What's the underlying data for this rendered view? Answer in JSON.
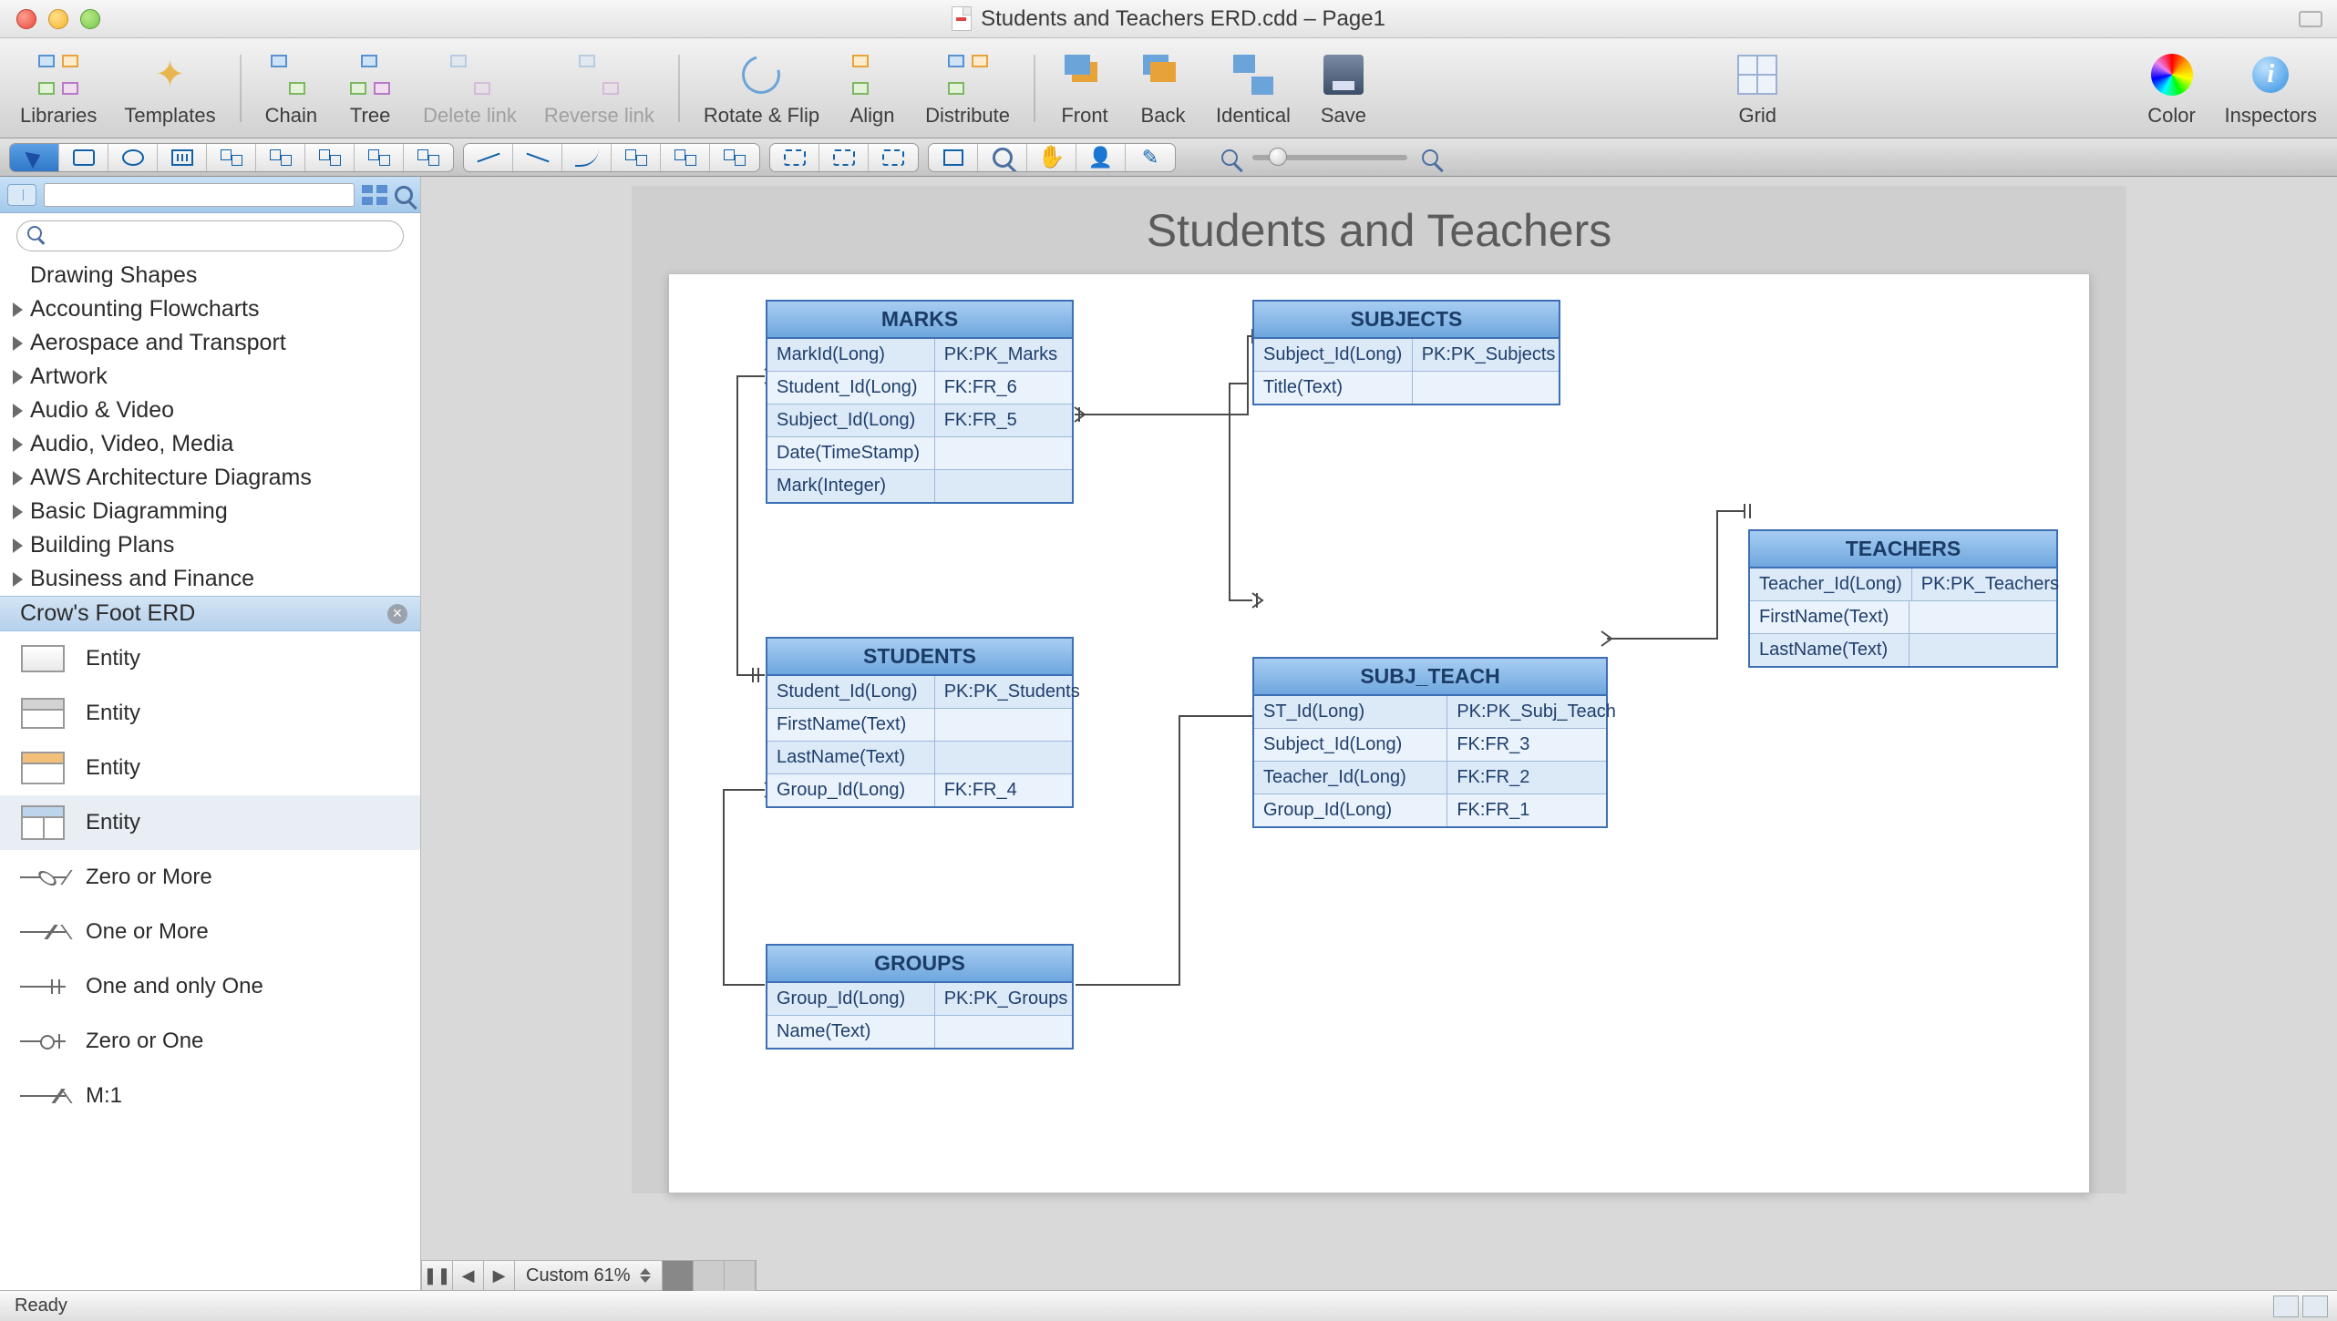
{
  "window": {
    "title": "Students and Teachers ERD.cdd – Page1"
  },
  "toolbar": {
    "libraries": "Libraries",
    "templates": "Templates",
    "chain": "Chain",
    "tree": "Tree",
    "delete_link": "Delete link",
    "reverse_link": "Reverse link",
    "rotate_flip": "Rotate & Flip",
    "align": "Align",
    "distribute": "Distribute",
    "front": "Front",
    "back": "Back",
    "identical": "Identical",
    "save": "Save",
    "grid": "Grid",
    "color": "Color",
    "inspectors": "Inspectors"
  },
  "sidebar": {
    "search_placeholder": "",
    "categories_heading": "Drawing Shapes",
    "categories": [
      "Accounting Flowcharts",
      "Aerospace and Transport",
      "Artwork",
      "Audio & Video",
      "Audio, Video, Media",
      "AWS Architecture Diagrams",
      "Basic Diagramming",
      "Building Plans",
      "Business and Finance"
    ],
    "selected_category": "Crow's Foot ERD",
    "shapes": [
      {
        "name": "Entity",
        "variant": "simple"
      },
      {
        "name": "Entity",
        "variant": "header"
      },
      {
        "name": "Entity",
        "variant": "pk"
      },
      {
        "name": "Entity",
        "variant": "cols"
      },
      {
        "name": "Zero or More",
        "variant": "zero-more"
      },
      {
        "name": "One or More",
        "variant": "one-more"
      },
      {
        "name": "One and only One",
        "variant": "one-one"
      },
      {
        "name": "Zero or One",
        "variant": "zero-one"
      },
      {
        "name": "M:1",
        "variant": "m1"
      }
    ]
  },
  "canvas": {
    "title": "Students and Teachers",
    "entities": {
      "marks": {
        "title": "MARKS",
        "rows": [
          {
            "c1": "MarkId(Long)",
            "c2": "PK:PK_Marks"
          },
          {
            "c1": "Student_Id(Long)",
            "c2": "FK:FR_6"
          },
          {
            "c1": "Subject_Id(Long)",
            "c2": "FK:FR_5"
          },
          {
            "c1": "Date(TimeStamp)",
            "c2": ""
          },
          {
            "c1": "Mark(Integer)",
            "c2": ""
          }
        ]
      },
      "subjects": {
        "title": "SUBJECTS",
        "rows": [
          {
            "c1": "Subject_Id(Long)",
            "c2": "PK:PK_Subjects"
          },
          {
            "c1": "Title(Text)",
            "c2": ""
          }
        ]
      },
      "students": {
        "title": "STUDENTS",
        "rows": [
          {
            "c1": "Student_Id(Long)",
            "c2": "PK:PK_Students"
          },
          {
            "c1": "FirstName(Text)",
            "c2": ""
          },
          {
            "c1": "LastName(Text)",
            "c2": ""
          },
          {
            "c1": "Group_Id(Long)",
            "c2": "FK:FR_4"
          }
        ]
      },
      "subj_teach": {
        "title": "SUBJ_TEACH",
        "rows": [
          {
            "c1": "ST_Id(Long)",
            "c2": "PK:PK_Subj_Teach"
          },
          {
            "c1": "Subject_Id(Long)",
            "c2": "FK:FR_3"
          },
          {
            "c1": "Teacher_Id(Long)",
            "c2": "FK:FR_2"
          },
          {
            "c1": "Group_Id(Long)",
            "c2": "FK:FR_1"
          }
        ]
      },
      "teachers": {
        "title": "TEACHERS",
        "rows": [
          {
            "c1": "Teacher_Id(Long)",
            "c2": "PK:PK_Teachers"
          },
          {
            "c1": "FirstName(Text)",
            "c2": ""
          },
          {
            "c1": "LastName(Text)",
            "c2": ""
          }
        ]
      },
      "groups": {
        "title": "GROUPS",
        "rows": [
          {
            "c1": "Group_Id(Long)",
            "c2": "PK:PK_Groups"
          },
          {
            "c1": "Name(Text)",
            "c2": ""
          }
        ]
      }
    }
  },
  "footer": {
    "zoom_label": "Custom 61%",
    "status": "Ready"
  }
}
